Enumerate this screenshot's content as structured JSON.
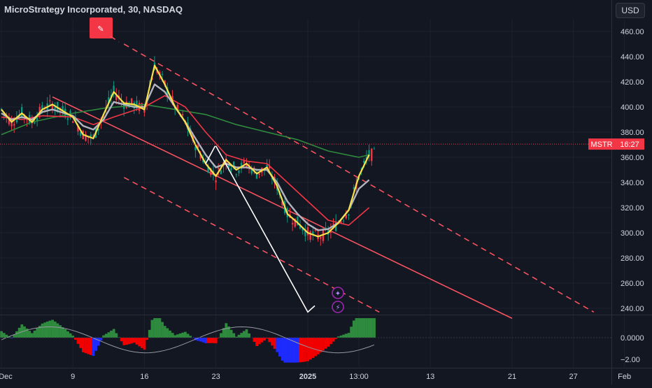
{
  "header": {
    "title": "MicroStrategy Incorporated, 30, NASDAQ",
    "currency": "USD"
  },
  "price_tag": {
    "ticker": "MSTR",
    "countdown": "16:27",
    "color": "#f23645"
  },
  "colors": {
    "background": "#131722",
    "bull": "#089981",
    "bear": "#f23645",
    "yellow_ma": "#f7e14b",
    "gray_ma": "#b2b5be",
    "red_ma": "#f23645",
    "green_ma": "#2e8b3e",
    "channel": "#f7525f",
    "hist_green": "#2e8b3e",
    "hist_red": "#f20000",
    "hist_blue": "#1e2bff"
  },
  "chart_data": {
    "type": "line",
    "title": "MicroStrategy Incorporated, 30, NASDAQ",
    "y_axis": {
      "range": [
        230,
        470
      ],
      "ticks": [
        "460.00",
        "440.00",
        "420.00",
        "400.00",
        "380.00",
        "360.00",
        "340.00",
        "320.00",
        "300.00",
        "280.00",
        "260.00",
        "240.00"
      ],
      "tick_values": [
        460,
        440,
        420,
        400,
        380,
        360,
        340,
        320,
        300,
        280,
        260,
        240
      ]
    },
    "x_axis": {
      "ticks": [
        "Dec",
        "9",
        "16",
        "23",
        "2025",
        "13:00",
        "13",
        "21",
        "27",
        "Feb"
      ],
      "tick_dates": [
        "2024-12-02",
        "2024-12-09",
        "2024-12-16",
        "2024-12-23",
        "2025-01-01",
        "2025-01-06",
        "2025-01-13",
        "2025-01-21",
        "2025-01-27",
        "2025-02-01"
      ]
    },
    "series": [
      {
        "type": "yellow-ma",
        "points": [
          [
            "2024-12-02",
            398
          ],
          [
            "2024-12-03",
            388
          ],
          [
            "2024-12-04",
            395
          ],
          [
            "2024-12-05",
            388
          ],
          [
            "2024-12-06",
            398
          ],
          [
            "2024-12-07",
            402
          ],
          [
            "2024-12-09",
            392
          ],
          [
            "2024-12-10",
            378
          ],
          [
            "2024-12-11",
            375
          ],
          [
            "2024-12-12",
            394
          ],
          [
            "2024-12-13",
            412
          ],
          [
            "2024-12-14",
            403
          ],
          [
            "2024-12-15",
            402
          ],
          [
            "2024-12-16",
            398
          ],
          [
            "2024-12-17",
            433
          ],
          [
            "2024-12-18",
            418
          ],
          [
            "2024-12-19",
            400
          ],
          [
            "2024-12-20",
            388
          ],
          [
            "2024-12-21",
            370
          ],
          [
            "2024-12-22",
            355
          ],
          [
            "2024-12-23",
            345
          ],
          [
            "2024-12-24",
            358
          ],
          [
            "2024-12-25",
            350
          ],
          [
            "2024-12-26",
            355
          ],
          [
            "2024-12-27",
            347
          ],
          [
            "2024-12-28",
            352
          ],
          [
            "2024-12-29",
            337
          ],
          [
            "2024-12-30",
            315
          ],
          [
            "2024-12-31",
            308
          ],
          [
            "2025-01-01",
            300
          ],
          [
            "2025-01-02",
            297
          ],
          [
            "2025-01-03",
            300
          ],
          [
            "2025-01-04",
            308
          ],
          [
            "2025-01-05",
            318
          ],
          [
            "2025-01-06",
            345
          ],
          [
            "2025-01-07",
            362
          ]
        ]
      },
      {
        "type": "gray-ma",
        "points": [
          [
            "2024-12-02",
            395
          ],
          [
            "2024-12-03",
            390
          ],
          [
            "2024-12-04",
            392
          ],
          [
            "2024-12-05",
            390
          ],
          [
            "2024-12-06",
            396
          ],
          [
            "2024-12-07",
            398
          ],
          [
            "2024-12-09",
            393
          ],
          [
            "2024-12-10",
            385
          ],
          [
            "2024-12-11",
            382
          ],
          [
            "2024-12-12",
            390
          ],
          [
            "2024-12-13",
            404
          ],
          [
            "2024-12-14",
            402
          ],
          [
            "2024-12-15",
            400
          ],
          [
            "2024-12-16",
            400
          ],
          [
            "2024-12-17",
            418
          ],
          [
            "2024-12-18",
            412
          ],
          [
            "2024-12-19",
            400
          ],
          [
            "2024-12-20",
            388
          ],
          [
            "2024-12-21",
            375
          ],
          [
            "2024-12-22",
            362
          ],
          [
            "2024-12-23",
            352
          ],
          [
            "2024-12-24",
            355
          ],
          [
            "2024-12-25",
            352
          ],
          [
            "2024-12-26",
            352
          ],
          [
            "2024-12-27",
            350
          ],
          [
            "2024-12-28",
            350
          ],
          [
            "2024-12-29",
            340
          ],
          [
            "2024-12-30",
            325
          ],
          [
            "2024-12-31",
            315
          ],
          [
            "2025-01-01",
            307
          ],
          [
            "2025-01-02",
            302
          ],
          [
            "2025-01-03",
            303
          ],
          [
            "2025-01-04",
            308
          ],
          [
            "2025-01-05",
            318
          ],
          [
            "2025-01-06",
            335
          ],
          [
            "2025-01-07",
            342
          ]
        ]
      },
      {
        "type": "red-ma",
        "points": [
          [
            "2024-12-02",
            392
          ],
          [
            "2024-12-04",
            390
          ],
          [
            "2024-12-06",
            393
          ],
          [
            "2024-12-09",
            392
          ],
          [
            "2024-12-11",
            386
          ],
          [
            "2024-12-13",
            392
          ],
          [
            "2024-12-16",
            400
          ],
          [
            "2024-12-18",
            409
          ],
          [
            "2024-12-20",
            400
          ],
          [
            "2024-12-22",
            380
          ],
          [
            "2024-12-24",
            362
          ],
          [
            "2024-12-26",
            357
          ],
          [
            "2024-12-28",
            355
          ],
          [
            "2024-12-30",
            340
          ],
          [
            "2025-01-01",
            325
          ],
          [
            "2025-01-03",
            310
          ],
          [
            "2025-01-05",
            306
          ],
          [
            "2025-01-07",
            320
          ]
        ]
      },
      {
        "type": "green-ma",
        "points": [
          [
            "2024-12-02",
            378
          ],
          [
            "2024-12-05",
            388
          ],
          [
            "2024-12-09",
            395
          ],
          [
            "2024-12-12",
            399
          ],
          [
            "2024-12-16",
            402
          ],
          [
            "2024-12-19",
            398
          ],
          [
            "2024-12-22",
            394
          ],
          [
            "2024-12-25",
            386
          ],
          [
            "2024-12-28",
            380
          ],
          [
            "2024-12-31",
            374
          ],
          [
            "2025-01-03",
            365
          ],
          [
            "2025-01-06",
            360
          ],
          [
            "2025-01-07",
            362
          ]
        ]
      }
    ],
    "current_price": 370.5,
    "lines": {
      "white_line": [
        [
          "2024-12-23",
          369
        ],
        [
          "2025-01-01",
          237
        ]
      ],
      "channel_mid": [
        [
          "2024-12-07",
          408
        ],
        [
          "2025-01-21",
          232
        ]
      ],
      "channel_upper": [
        [
          "2024-12-14",
          450
        ],
        [
          "2025-01-29",
          237
        ]
      ],
      "channel_lower": [
        [
          "2024-12-14",
          344
        ],
        [
          "2025-01-08",
          237
        ]
      ]
    },
    "oscillator": {
      "y_ticks": [
        "0.0000",
        "−2.00"
      ],
      "y_tick_values": [
        0,
        -2
      ]
    }
  }
}
